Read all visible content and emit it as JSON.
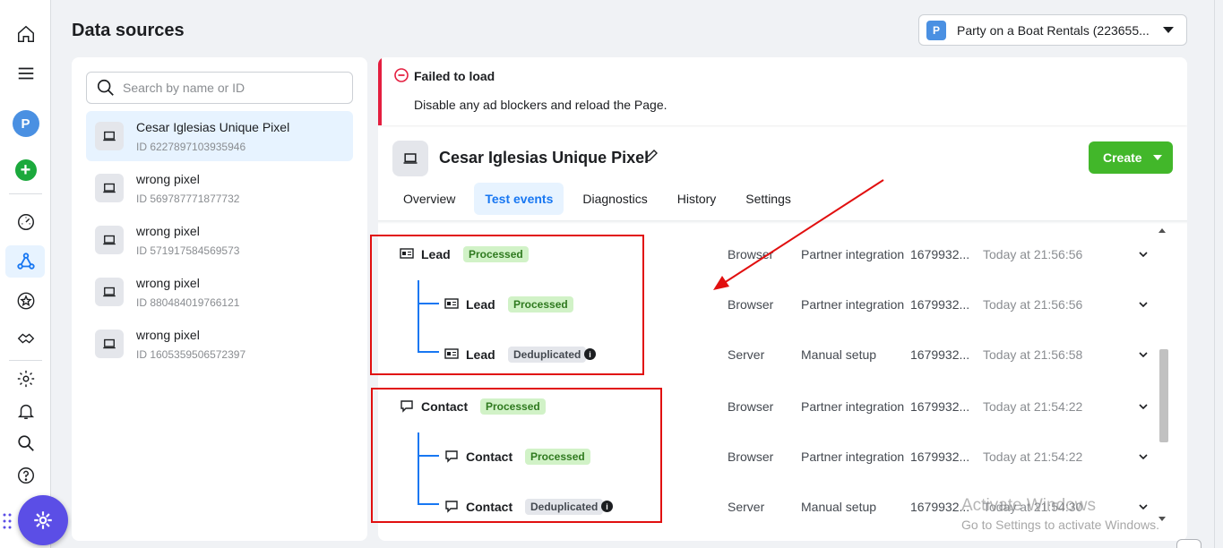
{
  "header": {
    "title": "Data sources",
    "account_badge": "P",
    "account_name": "Party on a Boat Rentals (223655..."
  },
  "rail": {
    "avatar_letter": "P",
    "icons": [
      "home-icon",
      "menu-icon",
      "profile-avatar",
      "add-icon",
      "dashboard-gauge-icon",
      "events-manager-icon",
      "star-icon",
      "handshake-icon",
      "gear-icon",
      "bell-icon",
      "search-icon",
      "help-icon",
      "asterisk-icon"
    ]
  },
  "search": {
    "placeholder": "Search by name or ID"
  },
  "sources": [
    {
      "name": "Cesar Iglesias Unique Pixel",
      "id": "ID 6227897103935946"
    },
    {
      "name": "wrong pixel",
      "id": "ID 569787771877732"
    },
    {
      "name": "wrong pixel",
      "id": "ID 571917584569573"
    },
    {
      "name": "wrong pixel",
      "id": "ID 880484019766121"
    },
    {
      "name": "wrong pixel",
      "id": "ID 1605359506572397"
    }
  ],
  "alert": {
    "title": "Failed to load",
    "body": "Disable any ad blockers and reload the Page."
  },
  "pixel": {
    "title": "Cesar Iglesias Unique Pixel",
    "create_label": "Create"
  },
  "tabs": [
    "Overview",
    "Test events",
    "Diagnostics",
    "History",
    "Settings"
  ],
  "events": [
    {
      "name": "Lead",
      "status": "Processed",
      "source": "Browser",
      "setup": "Partner integration",
      "event_id": "1679932...",
      "time": "Today at 21:56:56"
    },
    {
      "name": "Lead",
      "status": "Processed",
      "source": "Browser",
      "setup": "Partner integration",
      "event_id": "1679932...",
      "time": "Today at 21:56:56"
    },
    {
      "name": "Lead",
      "status": "Deduplicated",
      "source": "Server",
      "setup": "Manual setup",
      "event_id": "1679932...",
      "time": "Today at 21:56:58"
    },
    {
      "name": "Contact",
      "status": "Processed",
      "source": "Browser",
      "setup": "Partner integration",
      "event_id": "1679932...",
      "time": "Today at 21:54:22"
    },
    {
      "name": "Contact",
      "status": "Processed",
      "source": "Browser",
      "setup": "Partner integration",
      "event_id": "1679932...",
      "time": "Today at 21:54:22"
    },
    {
      "name": "Contact",
      "status": "Deduplicated",
      "source": "Server",
      "setup": "Manual setup",
      "event_id": "1679932...",
      "time": "Today at 21:54:30"
    }
  ],
  "watermark": {
    "line1": "Activate Windows",
    "line2": "Go to Settings to activate Windows."
  },
  "colors": {
    "brand_blue": "#1877f2",
    "create_green": "#42b72a",
    "processed_bg": "#d1f2c7",
    "alert_red": "#e41e3f",
    "annotation_red": "#e10f0f"
  }
}
